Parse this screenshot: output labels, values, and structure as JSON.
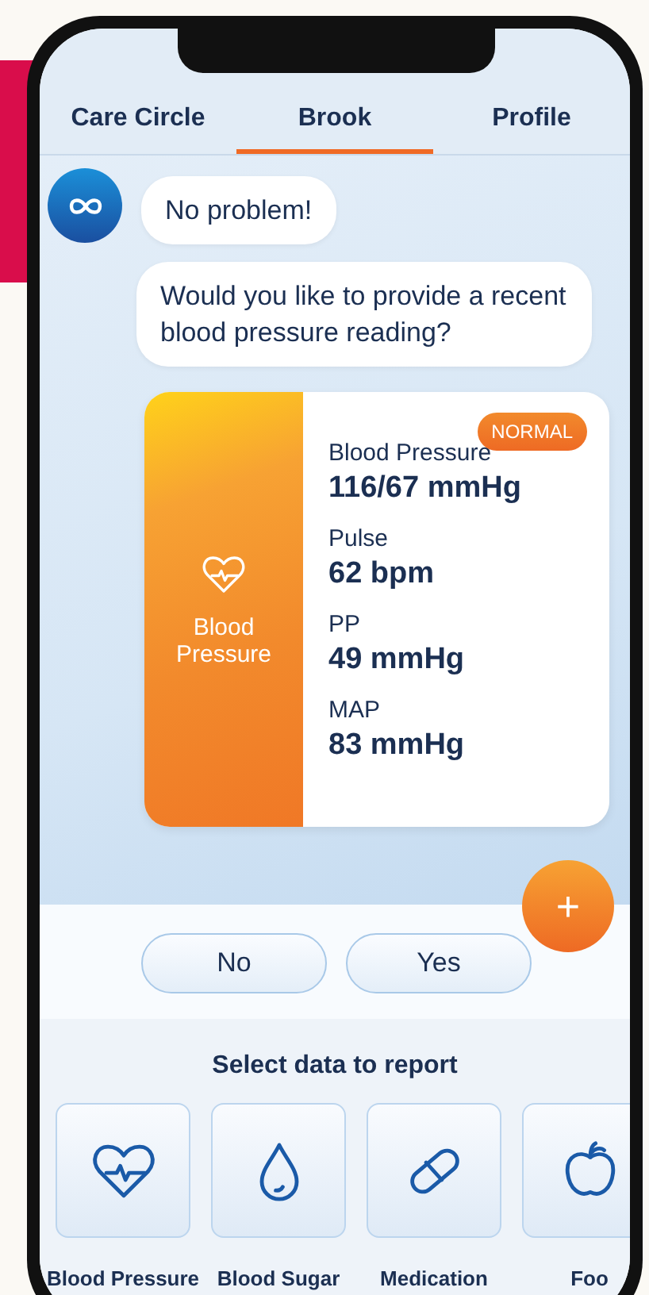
{
  "tabs": [
    {
      "label": "Care Circle",
      "selected": false
    },
    {
      "label": "Brook",
      "selected": true
    },
    {
      "label": "Profile",
      "selected": false
    }
  ],
  "chat": {
    "messages": [
      "No problem!",
      "Would you like to provide a recent blood pressure reading?"
    ],
    "card": {
      "title": "Blood Pressure",
      "badge": "NORMAL",
      "readings": [
        {
          "label": "Blood Pressure",
          "value": "116/67 mmHg"
        },
        {
          "label": "Pulse",
          "value": "62 bpm"
        },
        {
          "label": "PP",
          "value": "49 mmHg"
        },
        {
          "label": "MAP",
          "value": "83 mmHg"
        }
      ]
    },
    "fab": "+"
  },
  "answers": [
    "No",
    "Yes"
  ],
  "report": {
    "title": "Select data to report",
    "items": [
      {
        "kind": "heart",
        "label": "Blood Pressure"
      },
      {
        "kind": "drop",
        "label": "Blood Sugar"
      },
      {
        "kind": "pill",
        "label": "Medication"
      },
      {
        "kind": "apple",
        "label": "Foo"
      }
    ]
  }
}
